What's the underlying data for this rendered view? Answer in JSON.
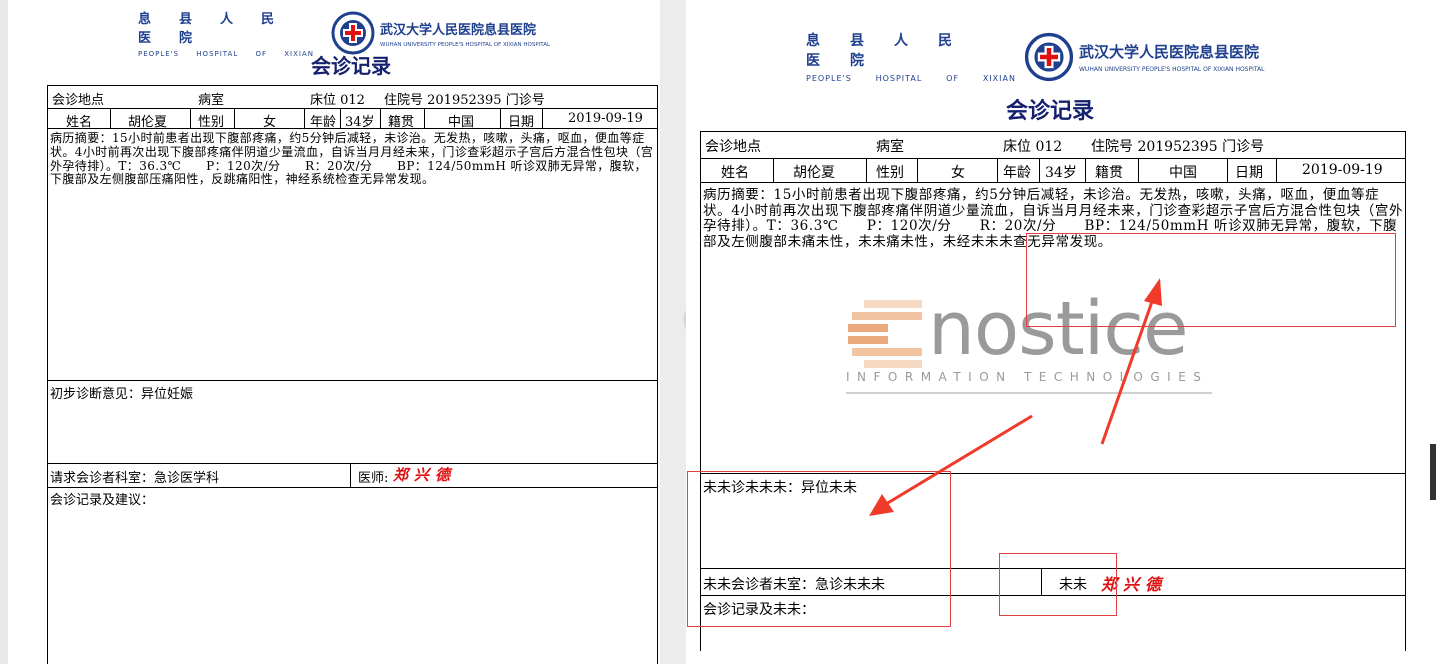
{
  "hospital": {
    "cn_name": "息县人民医院",
    "en_name": "PEOPLE'S HOSPITAL OF XIXIAN",
    "en_words": [
      "PEOPLE'S",
      "HOSPITAL",
      "OF",
      "XIXIAN"
    ],
    "right_cn": "武汉大学人民医院息县医院",
    "right_en": "WUHAN UNIVERSITY PEOPLE'S HOSPITAL OF XIXIAN HOSPITAL"
  },
  "colors": {
    "header_blue": "#1f3f8f",
    "title_blue": "#15206e",
    "annotation_red": "#e04040",
    "signature_red": "#e01010"
  },
  "left_doc": {
    "title": "会诊记录",
    "place_label": "会诊地点",
    "room": "病室",
    "bed": "床位 012",
    "admission": "住院号 201952395 门诊号",
    "name_label": "姓名",
    "name": "胡伦夏",
    "sex_label": "性别",
    "sex": "女",
    "age_label": "年龄",
    "age": "34岁",
    "native_label": "籍贯",
    "native": "中国",
    "date_label": "日期",
    "date": "2019-09-19",
    "history": "病历摘要：15小时前患者出现下腹部疼痛，约5分钟后减轻，未诊治。无发热，咳嗽，头痛，呕血，便血等症状。4小时前再次出现下腹部疼痛伴阴道少量流血，自诉当月月经未来，门诊查彩超示子宫后方混合性包块（宫外孕待排）。T：36.3℃　　P：120次/分　　R：20次/分　　BP：124/50mmH 听诊双肺无异常，腹软，下腹部及左侧腹部压痛阳性，反跳痛阳性，神经系统检查无异常发现。",
    "diagnosis": "初步诊断意见：异位妊娠",
    "dept": "请求会诊者科室：急诊医学科",
    "doctor_label": "医师:",
    "signature": "郑兴德",
    "record": "会诊记录及建议："
  },
  "right_doc": {
    "title": "会诊记录",
    "place_label": "会诊地点",
    "room": "病室",
    "bed": "床位 012",
    "admission": "住院号 201952395 门诊号",
    "name_label": "姓名",
    "name": "胡伦夏",
    "sex_label": "性别",
    "sex": "女",
    "age_label": "年龄",
    "age": "34岁",
    "native_label": "籍贯",
    "native": "中国",
    "date_label": "日期",
    "date": "2019-09-19",
    "history": "病历摘要：15小时前患者出现下腹部疼痛，约5分钟后减轻，未诊治。无发热，咳嗽，头痛，呕血，便血等症状。4小时前再次出现下腹部疼痛伴阴道少量流血，自诉当月月经未来，门诊查彩超示子宫后方混合性包块（宫外孕待排）。T：36.3℃　　P：120次/分　　R：20次/分　　BP：124/50mmH 听诊双肺无异常，腹软，下腹部及左侧腹部未痛未性，未未痛未性，未经未未未查无异常发现。",
    "diagnosis": "未未诊未未未：异位未未",
    "dept": "未未会诊者未室：急诊未未未",
    "doctor_label": "未未",
    "signature": "郑兴德",
    "record": "会诊记录及未未：",
    "watermark_word": "nostice",
    "watermark_sub": "INFORMATION TECHNOLOGIES"
  },
  "icons": {
    "logo": "hospital-cross-logo-icon",
    "nav": "chevron-left-icon",
    "arrow": "red-arrow-icon"
  }
}
